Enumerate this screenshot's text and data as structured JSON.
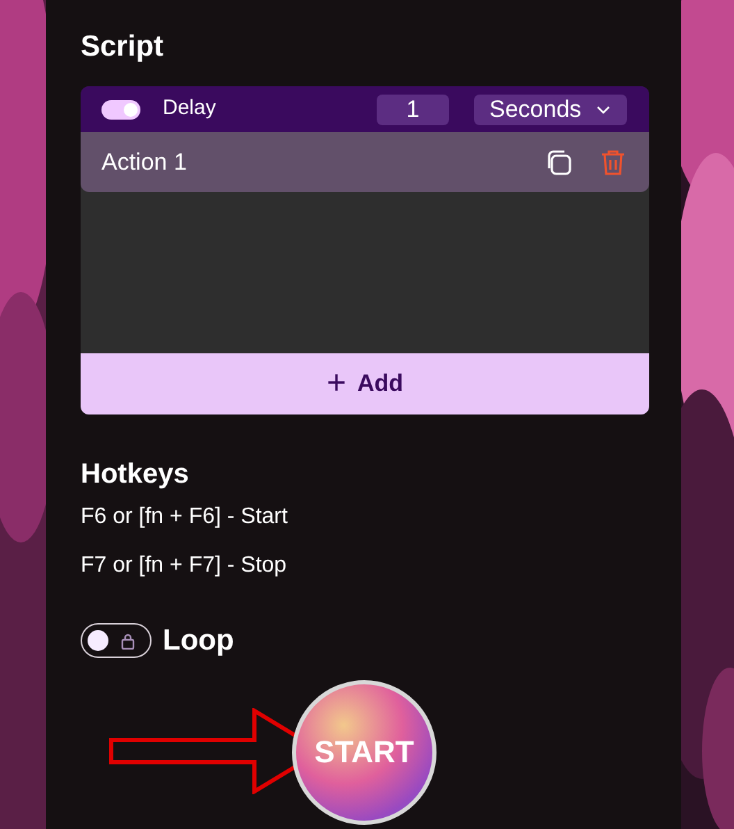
{
  "script": {
    "title": "Script",
    "delay": {
      "on": true,
      "label": "Delay",
      "value": "1",
      "unit": "Seconds"
    },
    "actions": [
      {
        "label": "Action 1"
      }
    ],
    "add_button": {
      "icon": "+",
      "label": "Add"
    }
  },
  "hotkeys": {
    "title": "Hotkeys",
    "lines": [
      "F6 or [fn + F6] - Start",
      "F7 or [fn + F7] - Stop"
    ]
  },
  "loop": {
    "on": false,
    "locked": true,
    "label": "Loop"
  },
  "start_button": {
    "label": "START"
  }
}
